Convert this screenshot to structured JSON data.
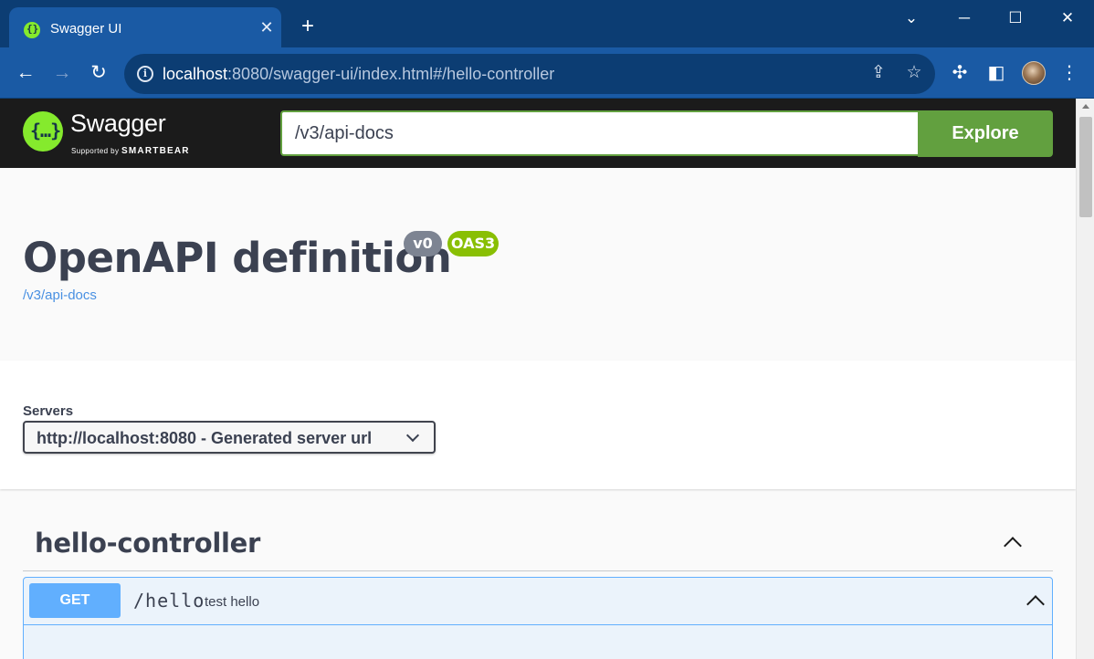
{
  "browser": {
    "tab_title": "Swagger UI",
    "tab_close": "✕",
    "new_tab": "+",
    "url_host": "localhost",
    "url_rest": ":8080/swagger-ui/index.html#/hello-controller"
  },
  "swagger": {
    "brand": "Swagger",
    "supported_by": "Supported by",
    "smartbear": "SMARTBEAR",
    "spec_url_value": "/v3/api-docs",
    "explore_label": "Explore",
    "accent_color": "#85ea2d",
    "explore_color": "#62a03f"
  },
  "info": {
    "title": "OpenAPI definition",
    "version_badge": "v0",
    "oas_badge": "OAS3",
    "spec_link": "/v3/api-docs"
  },
  "servers": {
    "label": "Servers",
    "selected": "http://localhost:8080 - Generated server url"
  },
  "tags": [
    {
      "name": "hello-controller",
      "operations": [
        {
          "method": "GET",
          "path": "/hello",
          "summary": "test hello",
          "method_color": "#61affe"
        }
      ]
    }
  ]
}
